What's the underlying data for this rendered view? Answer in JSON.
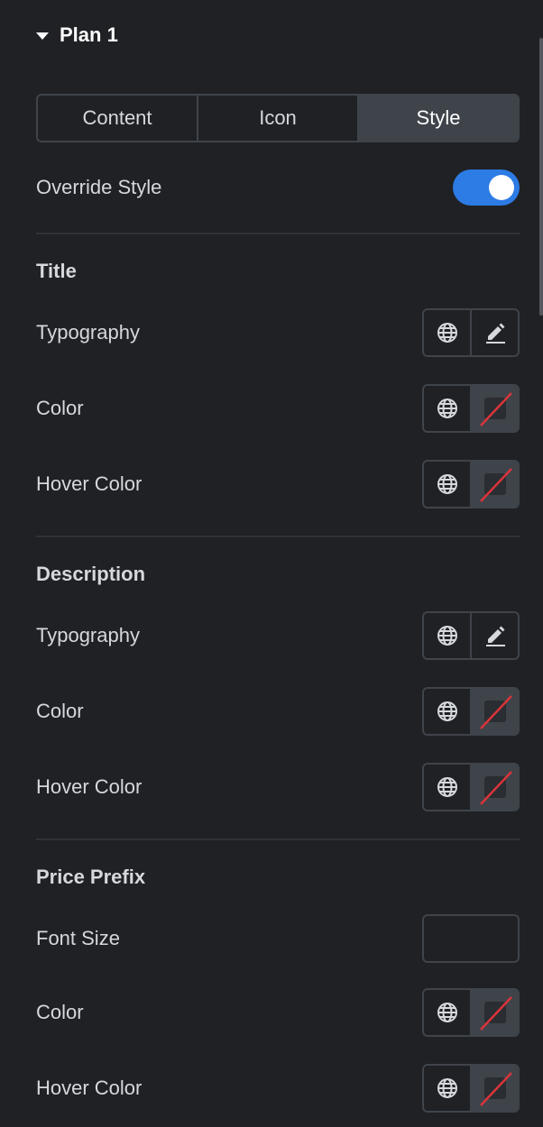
{
  "plan_header": {
    "title": "Plan 1",
    "expanded": true
  },
  "tabs": [
    {
      "label": "Content",
      "active": false
    },
    {
      "label": "Icon",
      "active": false
    },
    {
      "label": "Style",
      "active": true
    }
  ],
  "override_style": {
    "label": "Override Style",
    "enabled": true
  },
  "colors": {
    "accent": "#2d7be5",
    "panel_bg": "#1f2124",
    "border": "#3f444b",
    "no_color_slash": "#d9343a"
  },
  "sections": {
    "title": {
      "heading": "Title",
      "typography_label": "Typography",
      "color_label": "Color",
      "hover_color_label": "Hover Color"
    },
    "description": {
      "heading": "Description",
      "typography_label": "Typography",
      "color_label": "Color",
      "hover_color_label": "Hover Color"
    },
    "price_prefix": {
      "heading": "Price Prefix",
      "font_size_label": "Font Size",
      "font_size_value": "",
      "color_label": "Color",
      "hover_color_label": "Hover Color"
    }
  },
  "icons": {
    "globe": "globe-icon",
    "edit": "pencil-icon",
    "no_color": "no-color-swatch-icon",
    "caret": "caret-down-icon"
  }
}
